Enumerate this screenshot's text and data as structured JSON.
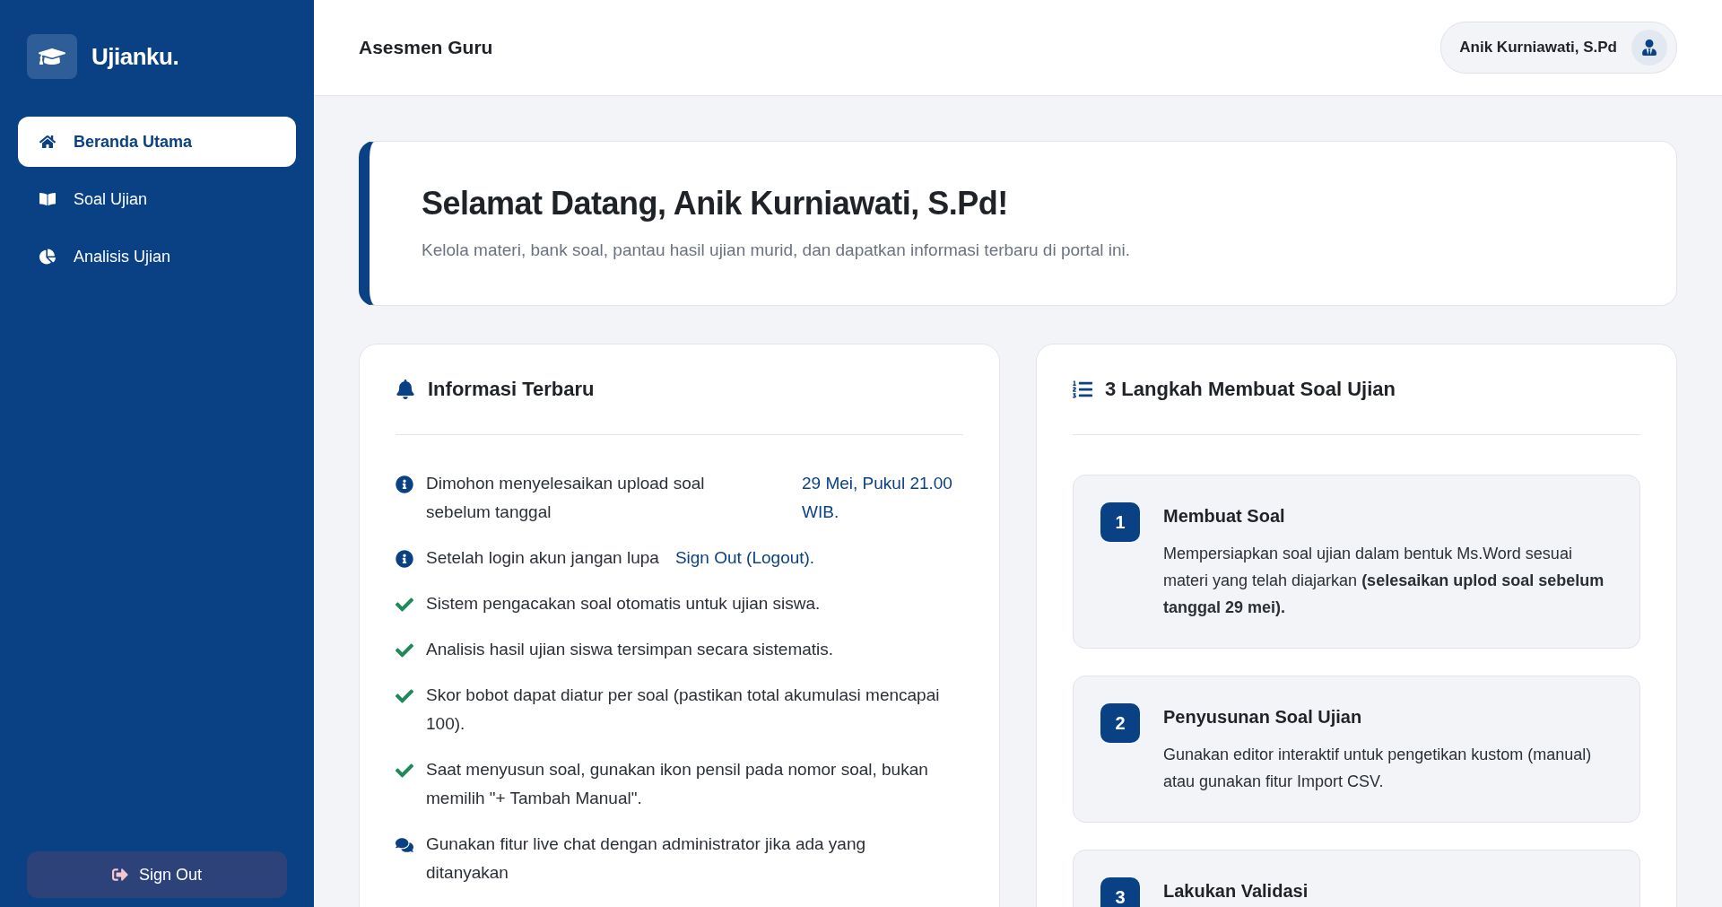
{
  "sidebar": {
    "brand": "Ujianku.",
    "items": [
      {
        "label": "Beranda Utama",
        "kind": "home",
        "selected": true
      },
      {
        "label": "Soal Ujian",
        "kind": "book",
        "selected": false
      },
      {
        "label": "Analisis Ujian",
        "kind": "chart",
        "selected": false
      }
    ],
    "sign_out": "Sign Out"
  },
  "header": {
    "title": "Asesmen Guru",
    "user": "Anik Kurniawati, S.Pd"
  },
  "welcome": {
    "title": "Selamat Datang, Anik Kurniawati, S.Pd!",
    "subtitle": "Kelola materi, bank soal, pantau hasil ujian murid, dan dapatkan informasi terbaru di portal ini."
  },
  "info": {
    "title": "Informasi Terbaru",
    "items": [
      {
        "kind": "deadline",
        "text": "Dimohon menyelesaikan upload soal sebelum tanggal",
        "highlight": "29 Mei, Pukul 21.00 WIB."
      },
      {
        "kind": "link",
        "text": "Setelah login akun jangan lupa",
        "highlight": "Sign Out (Logout)."
      },
      {
        "kind": "check",
        "text": "Sistem pengacakan soal otomatis untuk ujian siswa."
      },
      {
        "kind": "check",
        "text": "Analisis hasil ujian siswa tersimpan secara sistematis."
      },
      {
        "kind": "check",
        "text": "Skor bobot dapat diatur per soal (pastikan total akumulasi mencapai 100)."
      },
      {
        "kind": "check",
        "text": "Saat menyusun soal, gunakan ikon pensil pada nomor soal, bukan memilih \"+ Tambah Manual\"."
      },
      {
        "kind": "chat",
        "text": "Gunakan fitur live chat dengan administrator jika ada yang ditanyakan"
      }
    ]
  },
  "steps": {
    "title": "3 Langkah Membuat Soal Ujian",
    "items": [
      {
        "number": "1",
        "title": "Membuat Soal",
        "description": "Mempersiapkan soal ujian dalam bentuk Ms.Word sesuai materi yang telah diajarkan **(selesaikan uplod soal sebelum tanggal 29 mei).**"
      },
      {
        "number": "2",
        "title": "Penyusunan Soal Ujian",
        "description": "Gunakan editor interaktif untuk pengetikan kustom (manual) atau gunakan fitur Import CSV."
      },
      {
        "number": "3",
        "title": "Lakukan Validasi"
      }
    ]
  }
}
